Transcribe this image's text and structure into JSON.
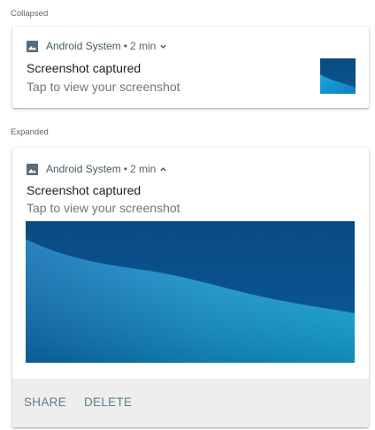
{
  "sections": {
    "collapsed_label": "Collapsed",
    "expanded_label": "Expanded"
  },
  "collapsed": {
    "app_name": "Android",
    "app_detail": "System",
    "separator": "•",
    "time": "2 min",
    "chevron": "chevron-down-icon",
    "title": "Screenshot captured",
    "subtitle": "Tap to view your screenshot"
  },
  "expanded": {
    "app_name": "Android",
    "app_detail": "System",
    "separator": "•",
    "time": "2 min",
    "chevron": "chevron-up-icon",
    "title": "Screenshot captured",
    "subtitle": "Tap to view your screenshot",
    "actions": {
      "share": "SHARE",
      "delete": "DELETE"
    }
  },
  "colors": {
    "header_text": "#455a64",
    "title_text": "#212121",
    "subtitle_text": "#757575",
    "action_text": "#607d8b",
    "action_bar": "#eeeeee",
    "image_dark": "#0a4f86",
    "image_light": "#0fa3d6"
  }
}
